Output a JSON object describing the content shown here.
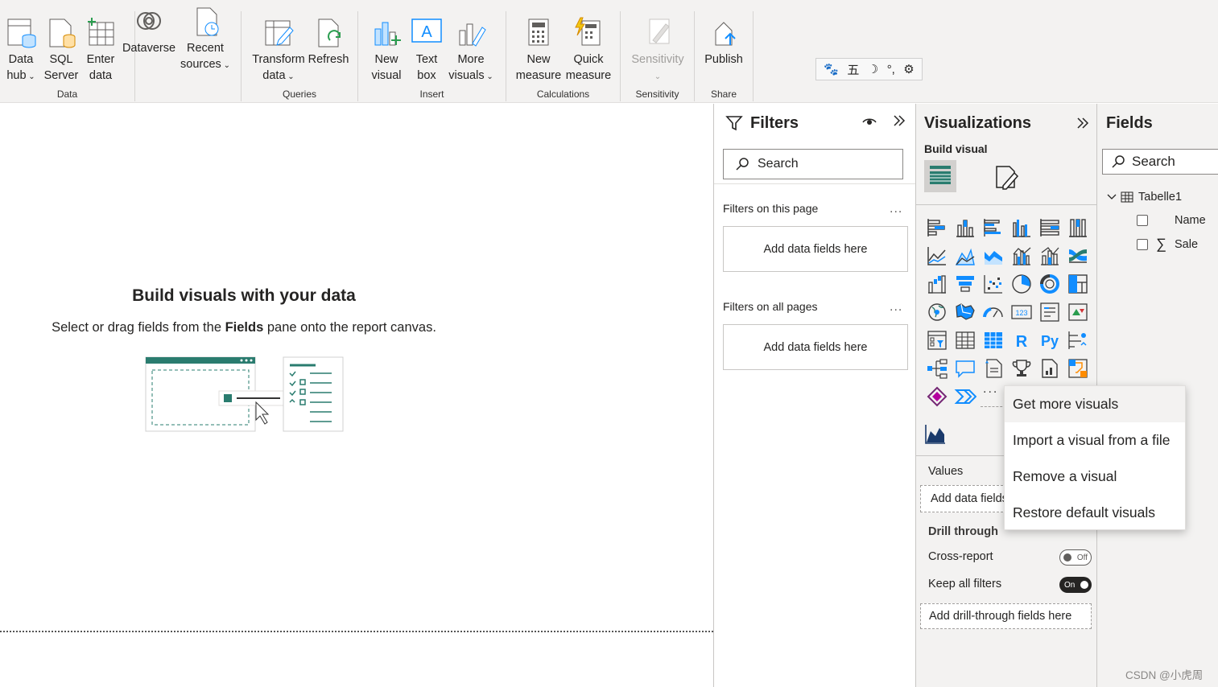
{
  "ribbon": {
    "groups": {
      "data": "Data",
      "queries": "Queries",
      "insert": "Insert",
      "calculations": "Calculations",
      "sensitivity": "Sensitivity",
      "share": "Share"
    },
    "buttons": {
      "data_hub": [
        "Data",
        "hub"
      ],
      "sql_server": [
        "SQL",
        "Server"
      ],
      "enter_data": [
        "Enter",
        "data"
      ],
      "dataverse": "Dataverse",
      "recent_sources": [
        "Recent",
        "sources"
      ],
      "transform_data": [
        "Transform",
        "data"
      ],
      "refresh": "Refresh",
      "new_visual": [
        "New",
        "visual"
      ],
      "text_box": [
        "Text",
        "box"
      ],
      "more_visuals": [
        "More",
        "visuals"
      ],
      "new_measure": [
        "New",
        "measure"
      ],
      "quick_measure": [
        "Quick",
        "measure"
      ],
      "sensitivity": "Sensitivity",
      "publish": "Publish"
    },
    "ime_bar": [
      "🐾",
      "五",
      "☽",
      "°,",
      "⚙"
    ]
  },
  "canvas": {
    "title": "Build visuals with your data",
    "subtitle_prefix": "Select or drag fields from the ",
    "subtitle_bold": "Fields",
    "subtitle_suffix": " pane onto the report canvas."
  },
  "filters": {
    "title": "Filters",
    "search_placeholder": "Search",
    "this_page_label": "Filters on this page",
    "this_page_well": "Add data fields here",
    "all_pages_label": "Filters on all pages",
    "all_pages_well": "Add data fields here",
    "more": "..."
  },
  "visualizations": {
    "title": "Visualizations",
    "build_visual": "Build visual",
    "more": "...",
    "values_label": "Values",
    "values_well": "Add data fields here",
    "drill_through": "Drill through",
    "cross_report": "Cross-report",
    "cross_report_state": "Off",
    "keep_all_filters": "Keep all filters",
    "keep_all_filters_state": "On",
    "drill_well": "Add drill-through fields here"
  },
  "context_menu": {
    "items": [
      "Get more visuals",
      "Import a visual from a file",
      "Remove a visual",
      "Restore default visuals"
    ]
  },
  "fields": {
    "title": "Fields",
    "search_placeholder": "Search",
    "table": "Tabelle1",
    "columns": [
      "Name",
      "Sale"
    ]
  },
  "watermark": "CSDN @小虎周",
  "colors": {
    "accent": "#118dff",
    "teal": "#2a7c6f",
    "ribbon_bg": "#f3f2f1",
    "pane_bg": "#f3f2f1"
  }
}
